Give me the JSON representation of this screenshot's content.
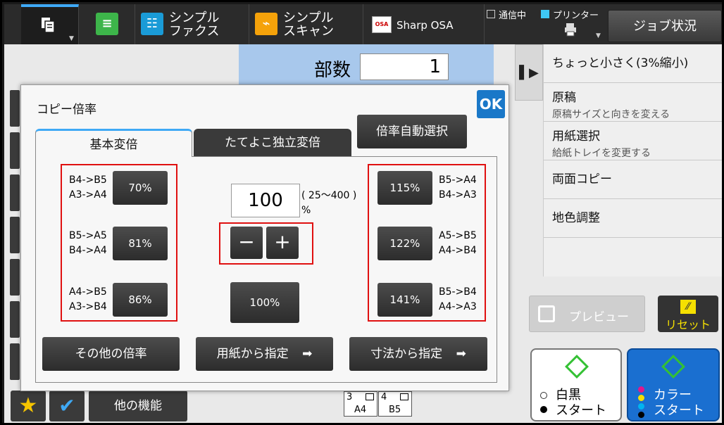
{
  "topbar": {
    "copy_icon": "copy-mode-icon",
    "fax_label_line1": "シンプル",
    "fax_label_line2": "ファクス",
    "scan_label_line1": "シンプル",
    "scan_label_line2": "スキャン",
    "osa_label": "Sharp OSA",
    "osa_icon_text": "OSA",
    "status_comm": "通信中",
    "status_printer": "プリンター",
    "job_status_label": "ジョブ状況"
  },
  "copies": {
    "label": "部数",
    "value": "1"
  },
  "side_menu": {
    "top_item": "ちょっと小さく(3%縮小)",
    "items": [
      {
        "title": "原稿",
        "sub": "原稿サイズと向きを変える"
      },
      {
        "title": "用紙選択",
        "sub": "給紙トレイを変更する"
      },
      {
        "title": "両面コピー",
        "sub": ""
      },
      {
        "title": "地色調整",
        "sub": ""
      }
    ]
  },
  "preview_label": "プレビュー",
  "reset_label": "リセット",
  "bw_start": {
    "line1": "白黒",
    "line2": "スタート"
  },
  "color_start": {
    "line1": "カラー",
    "line2": "スタート"
  },
  "bottom": {
    "other_functions": "他の機能",
    "tray1_num": "3",
    "tray1_size": "A4",
    "tray2_num": "4",
    "tray2_size": "B5"
  },
  "dialog": {
    "title": "コピー倍率",
    "ok": "OK",
    "tab_basic": "基本変倍",
    "tab_xy": "たてよこ独立変倍",
    "auto_ratio": "倍率自動選択",
    "reduce": [
      {
        "l1": "B4->B5",
        "l2": "A3->A4",
        "btn": "70%"
      },
      {
        "l1": "B5->A5",
        "l2": "B4->A4",
        "btn": "81%"
      },
      {
        "l1": "A4->B5",
        "l2": "A3->B4",
        "btn": "86%"
      }
    ],
    "enlarge": [
      {
        "l1": "B5->A4",
        "l2": "B4->A3",
        "btn": "115%"
      },
      {
        "l1": "A5->B5",
        "l2": "A4->B4",
        "btn": "122%"
      },
      {
        "l1": "B5->B4",
        "l2": "A4->A3",
        "btn": "141%"
      }
    ],
    "ratio_value": "100",
    "range": "( 25～400 )",
    "percent": "%",
    "minus": "−",
    "plus": "+",
    "btn_100": "100%",
    "btn_other": "その他の倍率",
    "btn_paper": "用紙から指定",
    "btn_size": "寸法から指定"
  },
  "colors": {
    "accent": "#3fa9f5",
    "ok_blue": "#1a78c8",
    "highlight_red": "#e01010",
    "copies_bg": "#a8c8ec",
    "color_start": "#1a6fd0",
    "start_green": "#34c134"
  }
}
